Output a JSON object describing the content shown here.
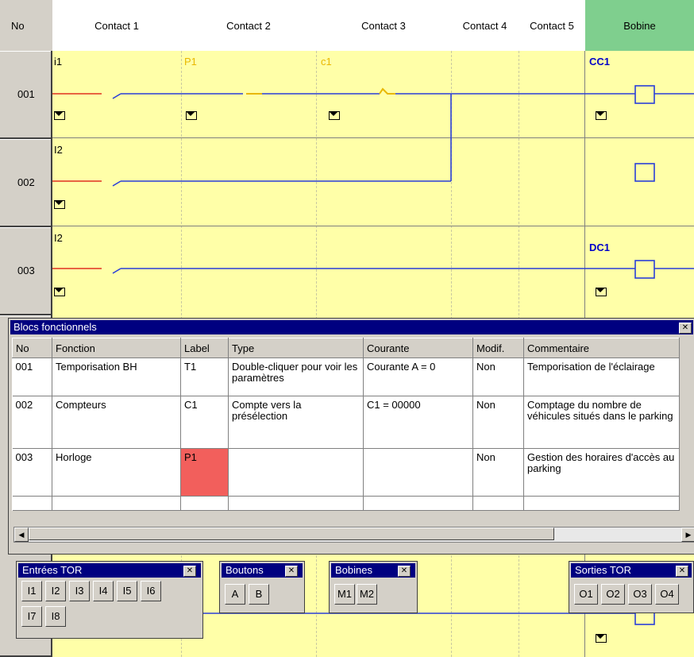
{
  "header": {
    "no": "No",
    "columns": [
      "Contact 1",
      "Contact 2",
      "Contact 3",
      "Contact 4",
      "Contact 5"
    ],
    "coil": "Bobine"
  },
  "rows": [
    {
      "no": "001",
      "contacts": [
        "i1",
        "P1",
        "c1"
      ],
      "coil": "CC1"
    },
    {
      "no": "002",
      "contacts": [
        "I2"
      ],
      "coil": ""
    },
    {
      "no": "003",
      "contacts": [
        "I2"
      ],
      "coil": "DC1"
    }
  ],
  "blocs": {
    "title": "Blocs fonctionnels",
    "columns": [
      "No",
      "Fonction",
      "Label",
      "Type",
      "Courante",
      "Modif.",
      "Commentaire"
    ],
    "rows": [
      {
        "no": "001",
        "fonction": "Temporisation BH",
        "label": "T1",
        "type": "Double-cliquer pour voir les paramètres",
        "courante": "Courante A = 0",
        "modif": "Non",
        "commentaire": "Temporisation de l'éclairage"
      },
      {
        "no": "002",
        "fonction": "Compteurs",
        "label": "C1",
        "type": "Compte vers la présélection",
        "courante": "C1 = 00000",
        "modif": "Non",
        "commentaire": "Comptage du nombre de véhicules situés dans le parking"
      },
      {
        "no": "003",
        "fonction": "Horloge",
        "label": "P1",
        "type": "",
        "courante": "",
        "modif": "Non",
        "commentaire": "Gestion des horaires d'accès au parking"
      }
    ]
  },
  "toolbars": {
    "entrees": {
      "title": "Entrées TOR",
      "buttons": [
        "I1",
        "I2",
        "I3",
        "I4",
        "I5",
        "I6",
        "I7",
        "I8"
      ]
    },
    "boutons": {
      "title": "Boutons",
      "buttons": [
        "A",
        "B"
      ]
    },
    "bobines": {
      "title": "Bobines",
      "buttons": [
        "M1",
        "M2"
      ]
    },
    "sorties": {
      "title": "Sorties TOR",
      "buttons": [
        "O1",
        "O2",
        "O3",
        "O4"
      ]
    }
  },
  "colors": {
    "ladder_bg": "#ffffa8",
    "wire": "#2a3fd8",
    "live_wire": "#e03020",
    "coil_header": "#7fcf8e",
    "title_bar": "#000080",
    "highlight_cell": "#f25f5c"
  },
  "icons": {
    "contact_comment": "envelope-icon",
    "close": "close-icon"
  }
}
